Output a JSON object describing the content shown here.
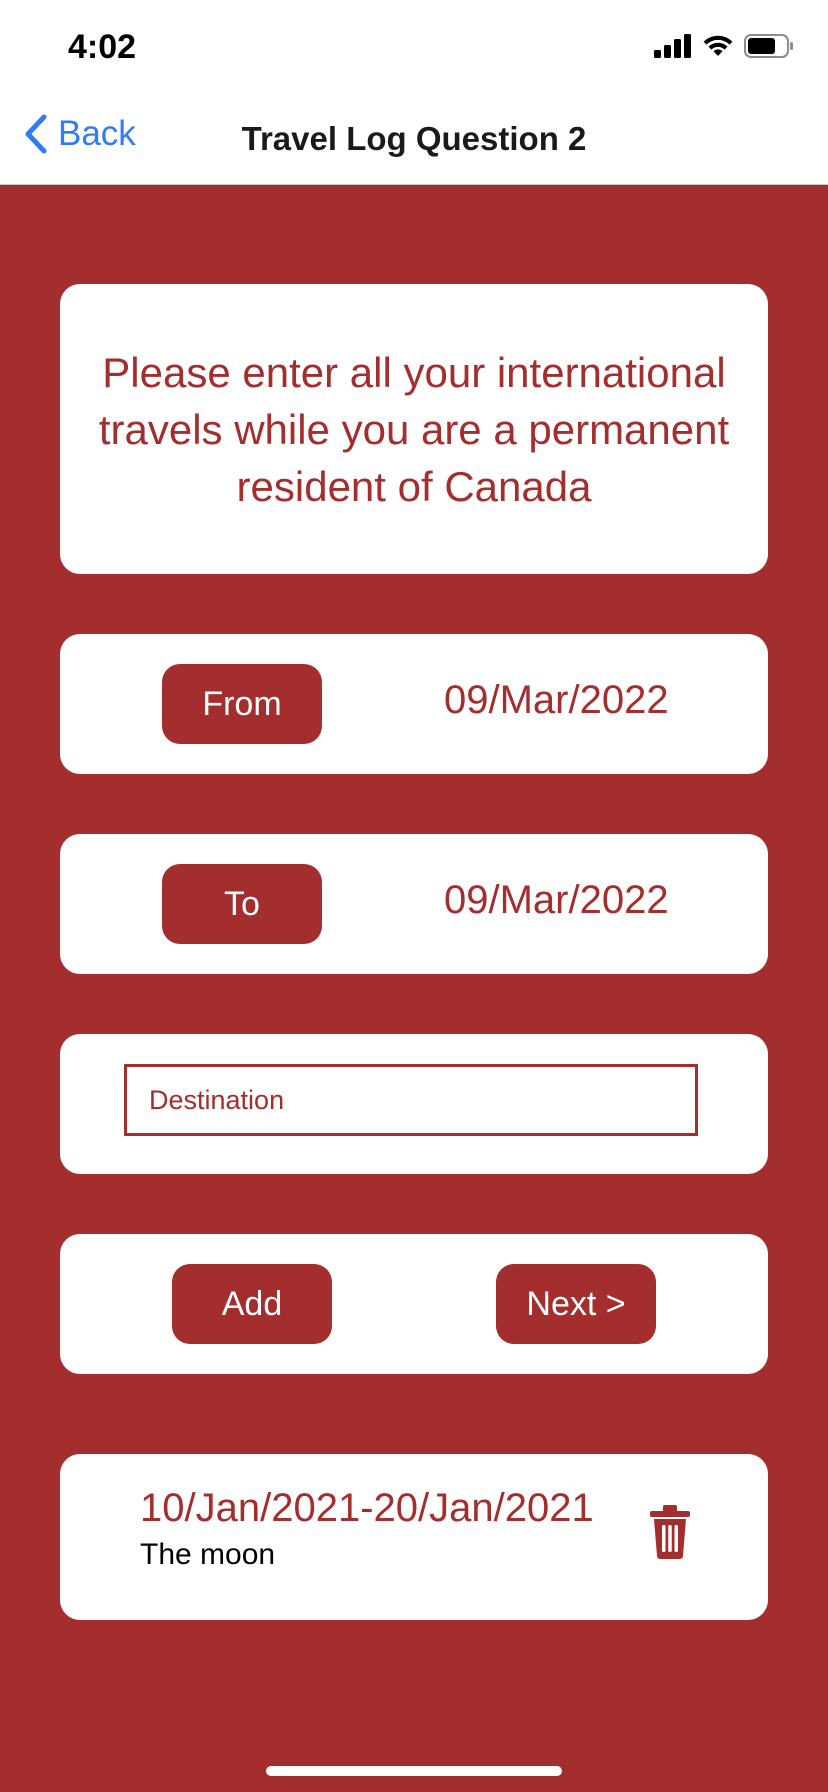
{
  "status_bar": {
    "time": "4:02",
    "icons": [
      "cellular-signal-icon",
      "wifi-icon",
      "battery-icon"
    ]
  },
  "nav": {
    "back_label": "Back",
    "title": "Travel Log Question 2"
  },
  "instruction": "Please enter all your international travels while you are a permanent resident of Canada",
  "from": {
    "button_label": "From",
    "date": "09/Mar/2022"
  },
  "to": {
    "button_label": "To",
    "date": "09/Mar/2022"
  },
  "destination": {
    "value": "",
    "placeholder": "Destination"
  },
  "actions": {
    "add_label": "Add",
    "next_label": "Next >"
  },
  "travel_log": [
    {
      "dates": "10/Jan/2021-20/Jan/2021",
      "destination": "The moon",
      "delete_icon": "trash-icon"
    }
  ],
  "colors": {
    "primary": "#a42e2d",
    "background": "#a42e2d",
    "card": "#ffffff",
    "link": "#2f7cf6"
  }
}
